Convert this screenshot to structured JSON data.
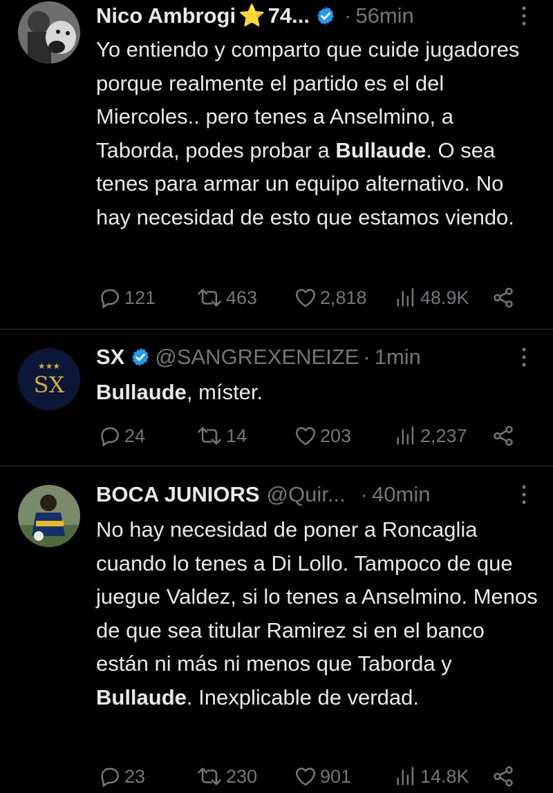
{
  "colors": {
    "background": "#000000",
    "text": "#e7e9ea",
    "secondary": "#71767b",
    "verified": "#1d9bf0",
    "star": "#f7c531",
    "divider": "#2f3336"
  },
  "tweets": [
    {
      "name": "Nico Ambrogi",
      "name_extra": "74...",
      "star": "⭐",
      "verified": true,
      "dot": "·",
      "time": "56min",
      "body": [
        {
          "text": "Yo entiendo y comparto que cuide jugadores porque realmente el partido es el del Miercoles.. pero tenes a Anselmino, a Taborda, podes probar a "
        },
        {
          "bold": "Bullaude"
        },
        {
          "text": ". O sea tenes para armar un equipo alternativo. No hay necesidad de esto que estamos viendo."
        }
      ],
      "replies": "121",
      "retweets": "463",
      "likes": "2,818",
      "views": "48.9K",
      "avatar_icon": "man-with-dog-photo"
    },
    {
      "name": "SX",
      "verified": true,
      "handle": "@SANGREXENEIZE",
      "dot": "·",
      "time": "1min",
      "body": [
        {
          "bold": "Bullaude"
        },
        {
          "text": ", míster."
        }
      ],
      "replies": "24",
      "retweets": "14",
      "likes": "203",
      "views": "2,237",
      "avatar_text": "SX",
      "avatar_stars": "★★★",
      "avatar_icon": "sx-logo"
    },
    {
      "name": "BOCA JUNIORS",
      "handle": "@Quir...",
      "dot": "·",
      "time": "40min",
      "body": [
        {
          "text": "No hay necesidad de poner a Roncaglia cuando lo tenes a Di Lollo. Tampoco de que juegue Valdez, si lo tenes a Anselmino. Menos de que sea titular Ramirez si en el banco están ni más ni menos que Taborda y "
        },
        {
          "bold": "Bullaude"
        },
        {
          "text": ".  Inexplicable de verdad."
        }
      ],
      "replies": "23",
      "retweets": "230",
      "likes": "901",
      "views": "14.8K",
      "avatar_icon": "football-player-photo"
    }
  ]
}
